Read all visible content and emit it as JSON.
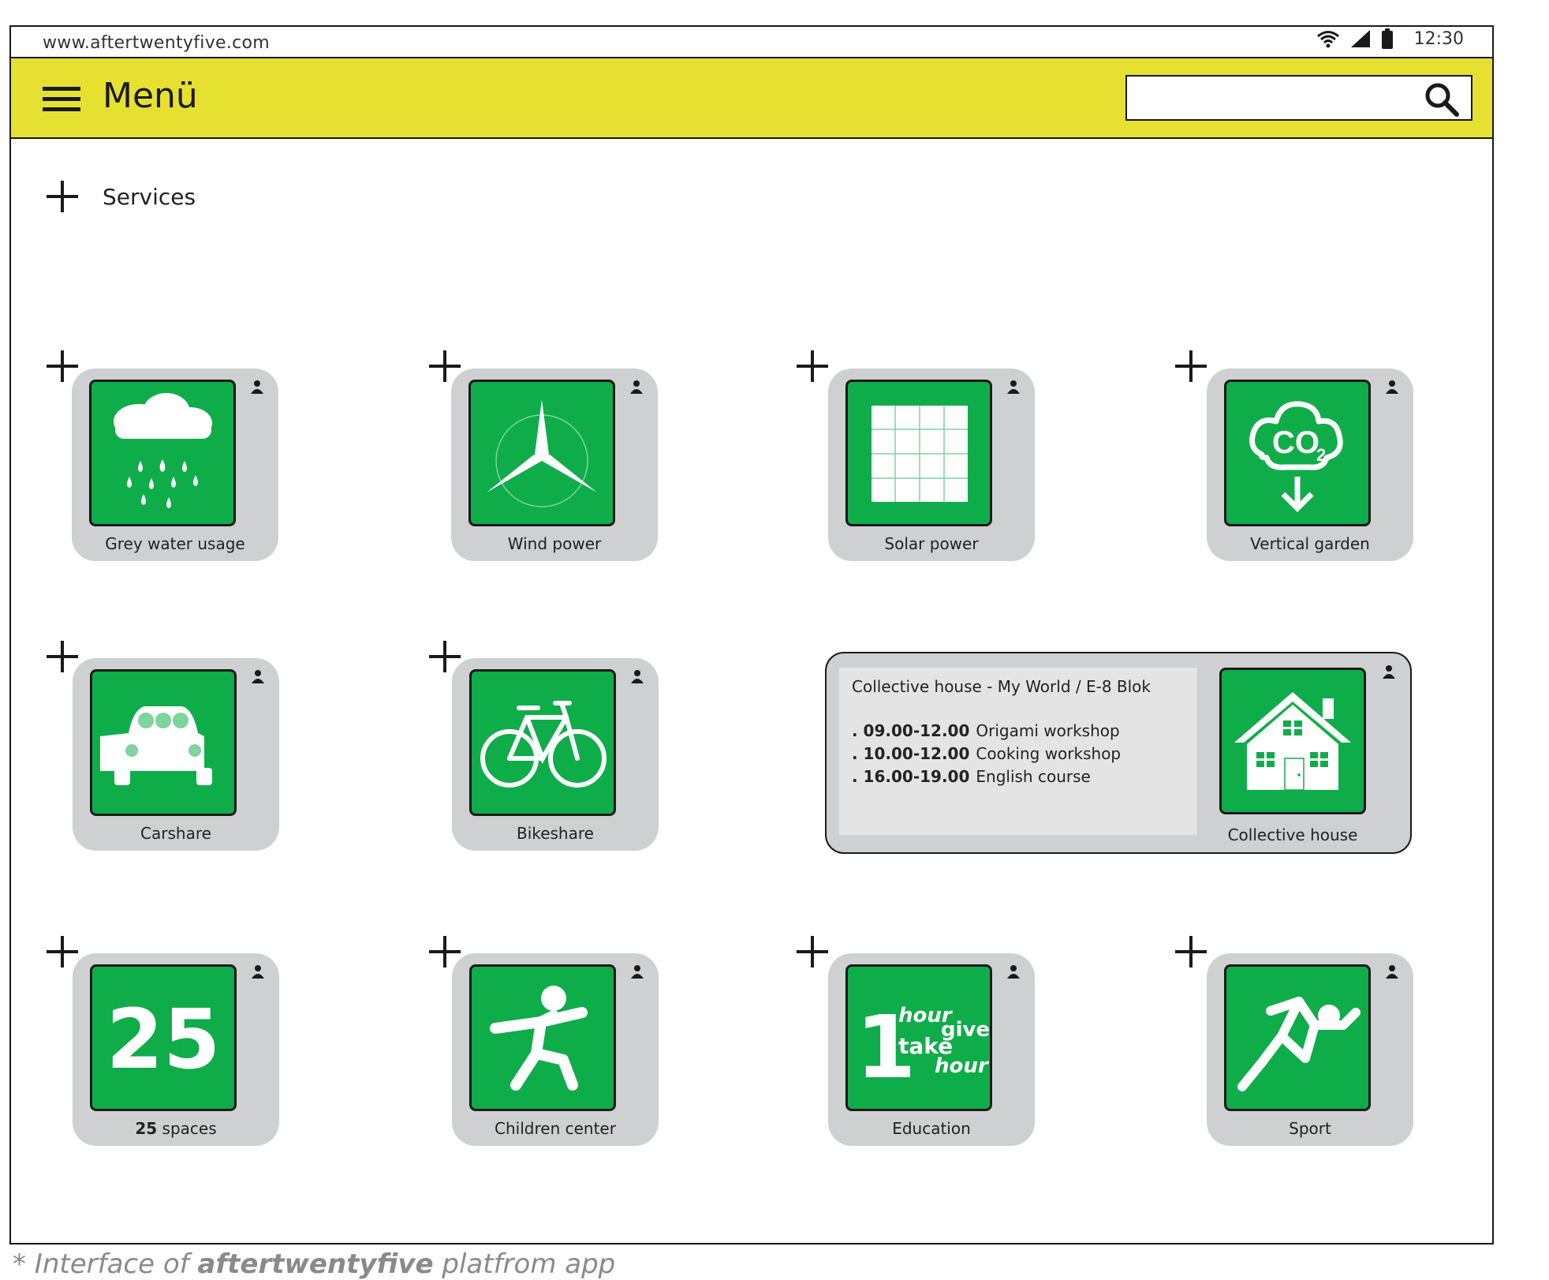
{
  "statusbar": {
    "url": "www.aftertwentyfive.com",
    "time": "12:30"
  },
  "header": {
    "menu_label": "Menü",
    "search_placeholder": ""
  },
  "section": {
    "label": "Services"
  },
  "tiles": [
    {
      "label": "Grey water usage",
      "icon": "grey-water-icon"
    },
    {
      "label": "Wind power",
      "icon": "wind-turbine-icon"
    },
    {
      "label": "Solar power",
      "icon": "solar-panel-icon"
    },
    {
      "label": "Vertical garden",
      "icon": "co2-cloud-icon"
    },
    {
      "label": "Carshare",
      "icon": "car-icon"
    },
    {
      "label": "Bikeshare",
      "icon": "bicycle-icon"
    },
    {
      "label": "Collective house",
      "icon": "house-icon"
    },
    {
      "label_bold": "25",
      "label_rest": " spaces",
      "icon": "number-25-icon",
      "icon_text": "25"
    },
    {
      "label": "Children center",
      "icon": "running-child-icon"
    },
    {
      "label": "Education",
      "icon": "time-bank-icon",
      "icon_text": {
        "one": "1",
        "hour1": "hour",
        "give": "give",
        "take": "take",
        "hour2": "hour"
      }
    },
    {
      "label": "Sport",
      "icon": "runner-icon"
    }
  ],
  "collective_panel": {
    "title": "Collective house - My World / E-8 Blok",
    "events": [
      {
        "time": ". 09.00-12.00",
        "name": "Origami workshop"
      },
      {
        "time": ". 10.00-12.00",
        "name": "Cooking workshop"
      },
      {
        "time": ". 16.00-19.00",
        "name": "English course"
      }
    ]
  },
  "caption": {
    "prefix": "* Interface of ",
    "brand": "aftertwentyfive",
    "suffix": " platfrom app"
  },
  "colors": {
    "accent_yellow": "#e6e131",
    "icon_green": "#0fad49",
    "tile_grey": "#cfd0d2"
  }
}
